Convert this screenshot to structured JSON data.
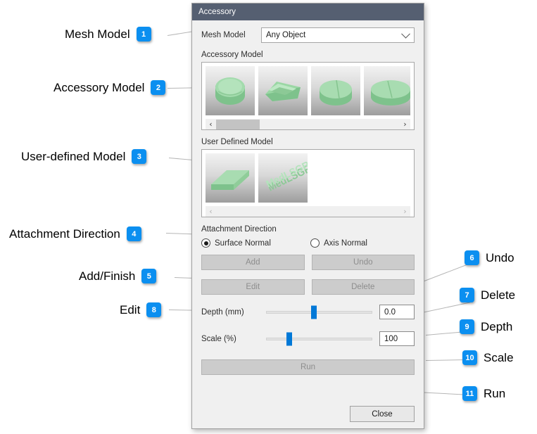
{
  "dialog": {
    "title": "Accessory",
    "mesh_model": {
      "label": "Mesh Model",
      "value": "Any Object"
    },
    "accessory_model": {
      "label": "Accessory Model",
      "scroll_left": "‹",
      "scroll_right": "›",
      "items": [
        {
          "name": "round-cap-accessory"
        },
        {
          "name": "bar-clip-accessory"
        },
        {
          "name": "round-tab-accessory"
        },
        {
          "name": "oval-tab-accessory"
        }
      ]
    },
    "user_defined_model": {
      "label": "User Defined Model",
      "scroll_left": "‹",
      "scroll_right": "›",
      "items": [
        {
          "name": "flat-slab-model"
        },
        {
          "name": "text-label-model"
        }
      ]
    },
    "attachment_direction": {
      "label": "Attachment Direction",
      "options": [
        {
          "label": "Surface Normal",
          "selected": true
        },
        {
          "label": "Axis Normal",
          "selected": false
        }
      ]
    },
    "buttons": {
      "add": "Add",
      "undo": "Undo",
      "edit": "Edit",
      "delete": "Delete",
      "run": "Run",
      "close": "Close"
    },
    "depth": {
      "label": "Depth (mm)",
      "value": "0.0",
      "slider_percent": 45
    },
    "scale": {
      "label": "Scale (%)",
      "value": "100",
      "slider_percent": 22
    }
  },
  "callouts": {
    "accent_color": "#0b8ff0",
    "left": [
      {
        "num": "1",
        "label": "Mesh Model"
      },
      {
        "num": "2",
        "label": "Accessory Model"
      },
      {
        "num": "3",
        "label": "User-defined Model"
      },
      {
        "num": "4",
        "label": "Attachment Direction"
      },
      {
        "num": "5",
        "label": "Add/Finish"
      },
      {
        "num": "8",
        "label": "Edit"
      }
    ],
    "right": [
      {
        "num": "6",
        "label": "Undo"
      },
      {
        "num": "7",
        "label": "Delete"
      },
      {
        "num": "9",
        "label": "Depth"
      },
      {
        "num": "10",
        "label": "Scale"
      },
      {
        "num": "11",
        "label": "Run"
      }
    ]
  }
}
